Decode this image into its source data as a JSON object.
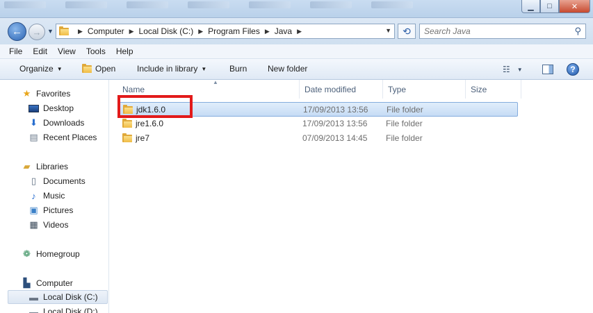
{
  "window": {
    "minimize_label": "▁",
    "maximize_label": "□",
    "close_label": "✕"
  },
  "address": {
    "breadcrumbs": [
      "Computer",
      "Local Disk (C:)",
      "Program Files",
      "Java"
    ],
    "search_placeholder": "Search Java"
  },
  "menu": [
    "File",
    "Edit",
    "View",
    "Tools",
    "Help"
  ],
  "commands": {
    "organize": "Organize",
    "open": "Open",
    "include_in_library": "Include in library",
    "burn": "Burn",
    "new_folder": "New folder"
  },
  "nav": {
    "favorites": "Favorites",
    "desktop": "Desktop",
    "downloads": "Downloads",
    "recent_places": "Recent Places",
    "libraries": "Libraries",
    "documents": "Documents",
    "music": "Music",
    "pictures": "Pictures",
    "videos": "Videos",
    "homegroup": "Homegroup",
    "computer": "Computer",
    "local_disk_c": "Local Disk (C:)",
    "local_disk_d": "Local Disk (D:)"
  },
  "columns": {
    "name": "Name",
    "date_modified": "Date modified",
    "type": "Type",
    "size": "Size"
  },
  "files": [
    {
      "name": "jdk1.6.0",
      "date": "17/09/2013 13:56",
      "type": "File folder",
      "selected": true
    },
    {
      "name": "jre1.6.0",
      "date": "17/09/2013 13:56",
      "type": "File folder",
      "selected": false
    },
    {
      "name": "jre7",
      "date": "07/09/2013 14:45",
      "type": "File folder",
      "selected": false
    }
  ],
  "colors": {
    "highlight_box": "#e21a1a",
    "folder_yellow": "#f0bc45",
    "selection": "#c6dcf5"
  }
}
